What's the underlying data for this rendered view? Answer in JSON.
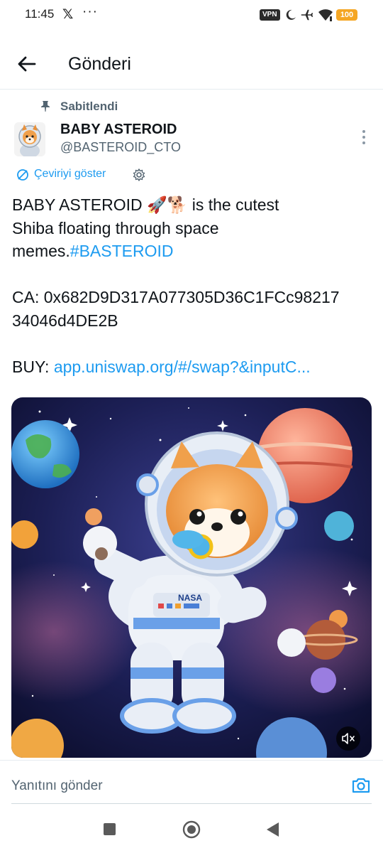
{
  "status_bar": {
    "time": "11:45",
    "x_icon": "x-logo-icon",
    "more": "···",
    "vpn": "VPN",
    "battery": "100",
    "colors": {
      "battery": "#f5a623"
    }
  },
  "header": {
    "title": "Gönderi",
    "back_icon": "arrow-left-icon"
  },
  "post": {
    "pinned_label": "Sabitlendi",
    "author_name": "BABY ASTEROID",
    "author_handle": "@BASTEROID_CTO",
    "translate_label": "Çeviriyi göster",
    "text": {
      "line1_prefix": "BABY ASTEROID ",
      "emoji": "🚀🐕",
      "line1_suffix": " is the cutest",
      "line2": "Shiba floating through space",
      "line3_prefix": "memes.",
      "hashtag": "#BASTEROID",
      "ca_line1": "CA: 0x682D9D317A077305D36C1FCc98217",
      "ca_line2": "34046d4DE2B",
      "buy_prefix": "BUY: ",
      "buy_link": "app.uniswap.org/#/swap?&inputC..."
    },
    "media": {
      "badge_text": "NASA",
      "mute_icon": "volume-mute-icon"
    }
  },
  "reply": {
    "placeholder": "Yanıtını gönder",
    "camera_icon": "camera-icon"
  },
  "colors": {
    "accent": "#1d9bf0",
    "text_primary": "#0f1419",
    "text_secondary": "#536471"
  }
}
